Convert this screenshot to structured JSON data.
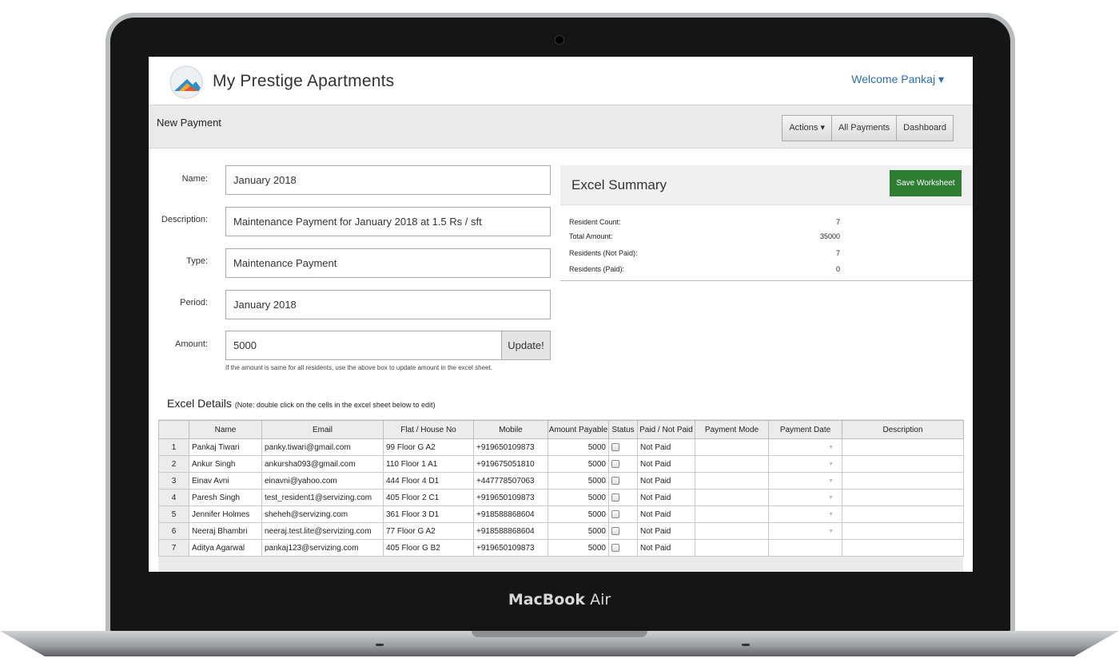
{
  "device": {
    "brand_bold": "MacBook",
    "brand_light": "Air"
  },
  "app": {
    "title": "My Prestige Apartments",
    "welcome": "Welcome Pankaj ▾"
  },
  "header": {
    "page_title": "New Payment",
    "buttons": {
      "actions": "Actions ▾",
      "all_payments": "All Payments",
      "dashboard": "Dashboard"
    }
  },
  "form": {
    "name": {
      "label": "Name:",
      "value": "January 2018"
    },
    "description": {
      "label": "Description:",
      "value": "Maintenance Payment for January 2018 at 1.5 Rs / sft"
    },
    "type": {
      "label": "Type:",
      "value": "Maintenance Payment"
    },
    "period": {
      "label": "Period:",
      "value": "January 2018"
    },
    "amount": {
      "label": "Amount:",
      "value": "5000",
      "button": "Update!"
    },
    "hint": "If the amount is same for all residents, use the above box to update amount in the excel sheet."
  },
  "summary": {
    "title": "Excel Summary",
    "save_button": "Save Worksheet",
    "rows": [
      {
        "label": "Resident Count:",
        "value": "7"
      },
      {
        "label": "Total Amount:",
        "value": "35000"
      },
      {
        "label": "Residents (Not Paid):",
        "value": "7"
      },
      {
        "label": "Residents (Paid):",
        "value": "0"
      }
    ]
  },
  "details": {
    "title": "Excel Details",
    "note": "(Note: double click on the cells in the excel sheet below to edit)",
    "columns": [
      "",
      "Name",
      "Email",
      "Flat / House No",
      "Mobile",
      "Amount Payable",
      "Status",
      "Paid / Not Paid",
      "Payment Mode",
      "Payment Date",
      "Description"
    ],
    "rows": [
      {
        "n": "1",
        "name": "Pankaj Tiwari",
        "email": "panky.tiwari@gmail.com",
        "flat": "99 Floor G A2",
        "mobile": "+919650109873",
        "amount": "5000",
        "paid": "Not Paid",
        "mode": "",
        "date": "▼",
        "desc": ""
      },
      {
        "n": "2",
        "name": "Ankur Singh",
        "email": "ankursha093@gmail.com",
        "flat": "110 Floor 1 A1",
        "mobile": "+919675051810",
        "amount": "5000",
        "paid": "Not Paid",
        "mode": "",
        "date": "▼",
        "desc": ""
      },
      {
        "n": "3",
        "name": "Einav Avni",
        "email": "einavni@yahoo.com",
        "flat": "444 Floor 4 D1",
        "mobile": "+447778507063",
        "amount": "5000",
        "paid": "Not Paid",
        "mode": "",
        "date": "▼",
        "desc": ""
      },
      {
        "n": "4",
        "name": "Paresh Singh",
        "email": "test_resident1@servizing.com",
        "flat": "405 Floor 2 C1",
        "mobile": "+919650109873",
        "amount": "5000",
        "paid": "Not Paid",
        "mode": "",
        "date": "▼",
        "desc": ""
      },
      {
        "n": "5",
        "name": "Jennifer Holmes",
        "email": "sheheh@servizing.com",
        "flat": "361 Floor 3 D1",
        "mobile": "+918588868604",
        "amount": "5000",
        "paid": "Not Paid",
        "mode": "",
        "date": "▼",
        "desc": ""
      },
      {
        "n": "6",
        "name": "Neeraj Bhambri",
        "email": "neeraj.test.lite@servizing.com",
        "flat": "77 Floor G A2",
        "mobile": "+918588868604",
        "amount": "5000",
        "paid": "Not Paid",
        "mode": "",
        "date": "▼",
        "desc": ""
      },
      {
        "n": "7",
        "name": "Aditya Agarwal",
        "email": "pankaj123@servizing.com",
        "flat": "405 Floor G B2",
        "mobile": "+919650109873",
        "amount": "5000",
        "paid": "Not Paid",
        "mode": "",
        "date": "",
        "desc": ""
      }
    ]
  },
  "colors": {
    "accent_blue": "#2a6db5",
    "save_green": "#2e7d32"
  },
  "icons": {
    "logo": "mountain-logo-icon",
    "checkbox": "checkbox-icon",
    "dropdown": "dropdown-arrow-icon"
  }
}
